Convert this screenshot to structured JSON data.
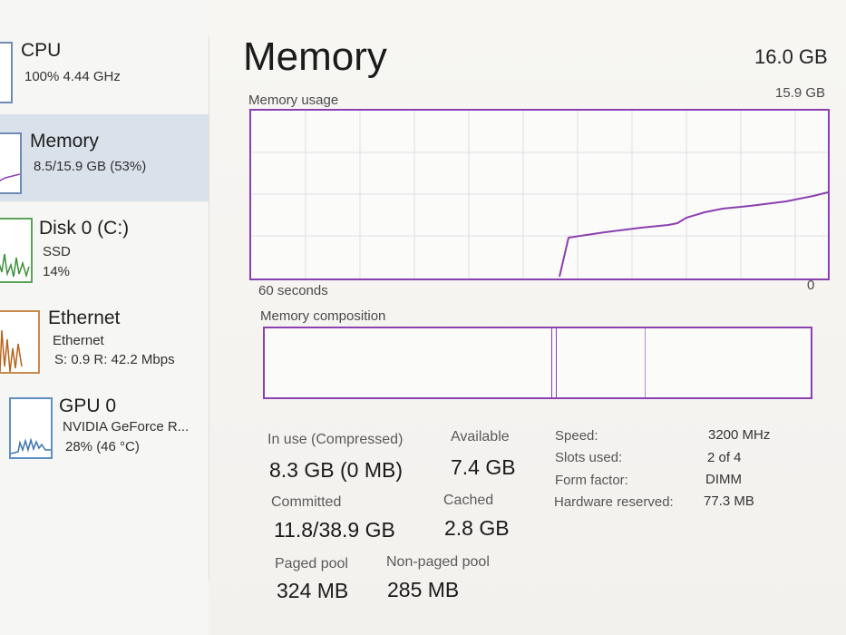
{
  "sidebar": {
    "items": [
      {
        "title": "CPU",
        "line1": "100% 4.44 GHz",
        "line2": "",
        "selected": false,
        "icon": "cpu-graph-thumbnail"
      },
      {
        "title": "Memory",
        "line1": "8.5/15.9 GB (53%)",
        "line2": "",
        "selected": true,
        "icon": "memory-graph-thumbnail"
      },
      {
        "title": "Disk 0 (C:)",
        "line1": "SSD",
        "line2": "14%",
        "selected": false,
        "icon": "disk-graph-thumbnail"
      },
      {
        "title": "Ethernet",
        "line1": "Ethernet",
        "line2": "S: 0.9 R: 42.2 Mbps",
        "selected": false,
        "icon": "ethernet-graph-thumbnail"
      },
      {
        "title": "GPU 0",
        "line1": "NVIDIA GeForce R...",
        "line2": "28% (46 °C)",
        "selected": false,
        "icon": "gpu-graph-thumbnail"
      }
    ]
  },
  "header": {
    "title": "Memory",
    "capacity": "16.0 GB"
  },
  "usage_chart": {
    "label": "Memory usage",
    "max_label": "15.9 GB",
    "x_left_label": "60 seconds",
    "x_right_label": "0",
    "line_color": "#8b3fb0"
  },
  "composition": {
    "label": "Memory composition"
  },
  "stats": {
    "in_use_label": "In use (Compressed)",
    "in_use_value": "8.3 GB (0 MB)",
    "available_label": "Available",
    "available_value": "7.4 GB",
    "committed_label": "Committed",
    "committed_value": "11.8/38.9 GB",
    "cached_label": "Cached",
    "cached_value": "2.8 GB",
    "paged_label": "Paged pool",
    "paged_value": "324 MB",
    "nonpaged_label": "Non-paged pool",
    "nonpaged_value": "285 MB"
  },
  "hardware": {
    "speed_label": "Speed:",
    "speed_value": "3200 MHz",
    "slots_label": "Slots used:",
    "slots_value": "2 of 4",
    "form_label": "Form factor:",
    "form_value": "DIMM",
    "reserved_label": "Hardware reserved:",
    "reserved_value": "77.3 MB"
  }
}
